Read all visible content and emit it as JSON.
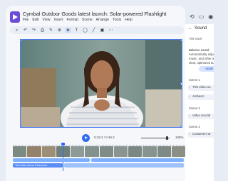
{
  "window": {
    "title": "Cymbal Outdoor Goods latest launch: Solar-powered Flashlight",
    "menu": [
      "File",
      "Edit",
      "View",
      "Insert",
      "Format",
      "Scene",
      "Arrange",
      "Tools",
      "Help"
    ]
  },
  "toolbar": {
    "icons": [
      "search-icon",
      "undo-icon",
      "redo-icon",
      "print-icon",
      "format-paint-icon",
      "zoom-icon",
      "pointer-icon",
      "text-box-icon",
      "shape-icon",
      "pen-icon",
      "image-icon",
      "more-icon"
    ]
  },
  "canvas": {
    "description_visible": false,
    "accent": "#4a7cf0"
  },
  "timeline": {
    "timecode": "0:19.2 / 0:46.2",
    "zoom": "100%",
    "clip_label": "This video above Panoramic",
    "accent": "#2f6cf3"
  },
  "side_icons": [
    "history-icon",
    "comment-icon",
    "account-icon"
  ],
  "panel": {
    "title": "Sound",
    "track_label": "Title track",
    "balance_title": "Balance sound",
    "balance_desc": [
      "Automatically adjust",
      "music, and other au",
      "clear, optimized aud"
    ],
    "apply_label": "Apply",
    "scenes": [
      {
        "name": "Scene 1",
        "rows": [
          "This video ou",
          "Ambient"
        ]
      },
      {
        "name": "Scene 2",
        "rows": [
          "Video recordi"
        ]
      },
      {
        "name": "Scene 3",
        "rows": [
          "Customers ar"
        ]
      }
    ]
  }
}
